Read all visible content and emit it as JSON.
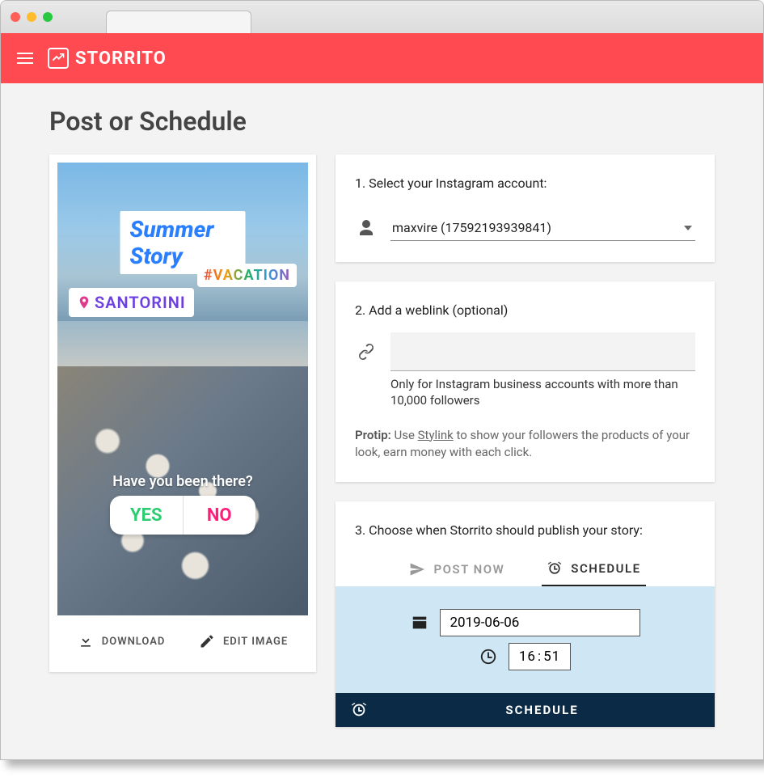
{
  "brand": {
    "name": "STORRITO"
  },
  "page": {
    "title": "Post or Schedule"
  },
  "story": {
    "title": "Summer Story",
    "hashtag": "#VACATION",
    "location": "SANTORINI",
    "poll_question": "Have you been there?",
    "poll_yes": "YES",
    "poll_no": "NO"
  },
  "actions": {
    "download": "DOWNLOAD",
    "edit_image": "EDIT IMAGE"
  },
  "step1": {
    "label": "1. Select your Instagram account:",
    "selected": "maxvire (17592193939841)"
  },
  "step2": {
    "label": "2. Add a weblink (optional)",
    "value": "",
    "hint": "Only for Instagram business accounts with more than 10,000 followers",
    "protip_prefix": "Protip:",
    "protip_mid": " Use ",
    "protip_link": "Stylink",
    "protip_rest": " to show your followers the products of your look, earn money with each click."
  },
  "step3": {
    "label": "3. Choose when Storrito should publish your story:",
    "tab_post_now": "POST NOW",
    "tab_schedule": "SCHEDULE",
    "date": "2019-06-06",
    "time_h": "16",
    "time_m": "51",
    "button": "SCHEDULE"
  }
}
